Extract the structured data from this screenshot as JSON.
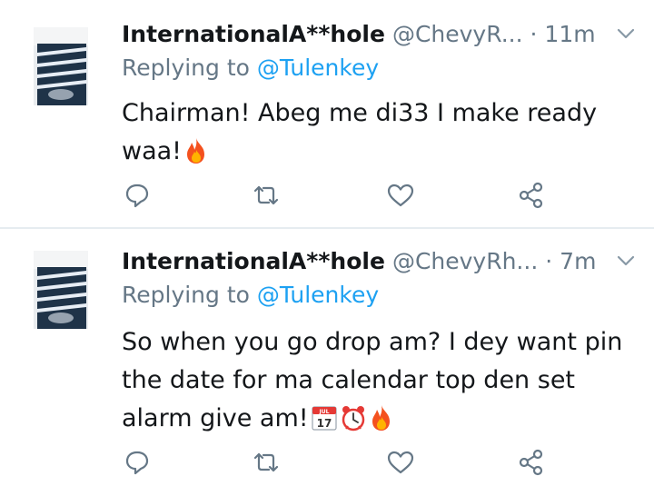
{
  "tweets": [
    {
      "name": "InternationalA**hole",
      "handle": "@ChevyR...",
      "time": "· 11m",
      "replying_prefix": "Replying to",
      "replying_to": "@Tulenkey",
      "text": "Chairman! Abeg me di33 I make ready waa!",
      "emojis": [
        "fire-emoji"
      ]
    },
    {
      "name": "InternationalA**hole",
      "handle": "@ChevyRh...",
      "time": "· 7m",
      "replying_prefix": "Replying to",
      "replying_to": "@Tulenkey",
      "text": "So when you go drop am? I dey want pin the date for ma calendar top den set alarm give am!",
      "emojis": [
        "calendar-emoji",
        "alarm-clock-emoji",
        "fire-emoji"
      ]
    }
  ],
  "calendar_emoji": {
    "month": "JUL",
    "day": "17"
  },
  "colors": {
    "text": "#14171a",
    "secondary": "#657786",
    "link": "#1da1f2",
    "icon": "#657786",
    "divider": "#e6ecf0"
  }
}
